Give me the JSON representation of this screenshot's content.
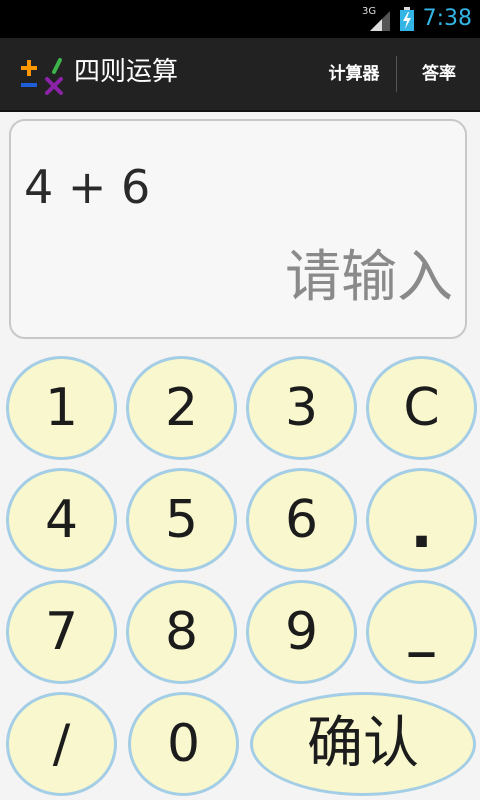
{
  "status_bar": {
    "network": "3G",
    "time": "7:38"
  },
  "app": {
    "title": "四则运算",
    "actions": {
      "calculator": "计算器",
      "answer_rate": "答率"
    }
  },
  "display": {
    "expression": "4 + 6",
    "answer_placeholder": "请输入"
  },
  "keypad": {
    "rows": [
      [
        "1",
        "2",
        "3",
        "C"
      ],
      [
        "4",
        "5",
        "6",
        "."
      ],
      [
        "7",
        "8",
        "9",
        "_"
      ],
      [
        "/",
        "0",
        "确认"
      ]
    ]
  },
  "colors": {
    "status_time": "#33b5e5",
    "action_bar": "#222222",
    "key_fill": "#f8f7cd",
    "key_border": "#a4cde6",
    "display_border": "#c8c8c8",
    "placeholder": "#8a8a8a"
  }
}
